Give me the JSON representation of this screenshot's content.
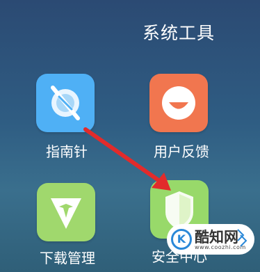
{
  "folder": {
    "title": "系统工具"
  },
  "apps": [
    {
      "label": "指南针",
      "icon": "compass-icon",
      "color": "#4fb0f5"
    },
    {
      "label": "用户反馈",
      "icon": "smile-face-icon",
      "color": "#f1764f"
    },
    {
      "label": "下载管理",
      "icon": "download-plane-icon",
      "color": "#a0d86d"
    },
    {
      "label": "安全中心",
      "icon": "shield-icon",
      "color": "#98d96a"
    }
  ],
  "annotation": {
    "arrow_color": "#e22b2b"
  },
  "watermark": {
    "title": "酷知网",
    "url": "www.coozhi.com",
    "logo_letter": "K"
  }
}
